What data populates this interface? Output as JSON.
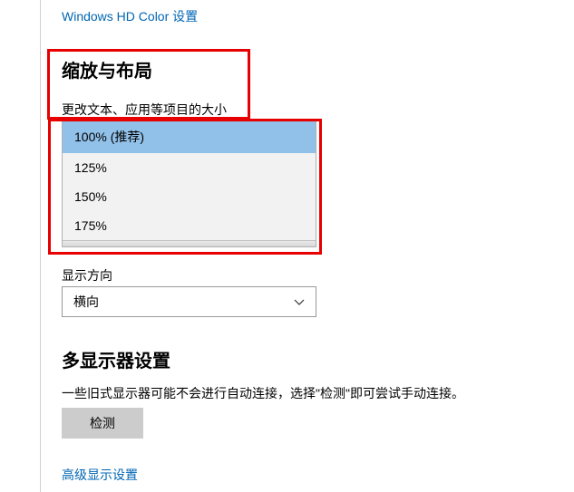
{
  "topLink": "Windows HD Color 设置",
  "scaling": {
    "heading": "缩放与布局",
    "sizeLabel": "更改文本、应用等项目的大小",
    "options": [
      "100% (推荐)",
      "125%",
      "150%",
      "175%"
    ],
    "orientationLabel": "显示方向",
    "orientationValue": "横向"
  },
  "multi": {
    "heading": "多显示器设置",
    "desc": "一些旧式显示器可能不会进行自动连接，选择\"检测\"即可尝试手动连接。",
    "detectBtn": "检测"
  },
  "advLink": "高级显示设置"
}
